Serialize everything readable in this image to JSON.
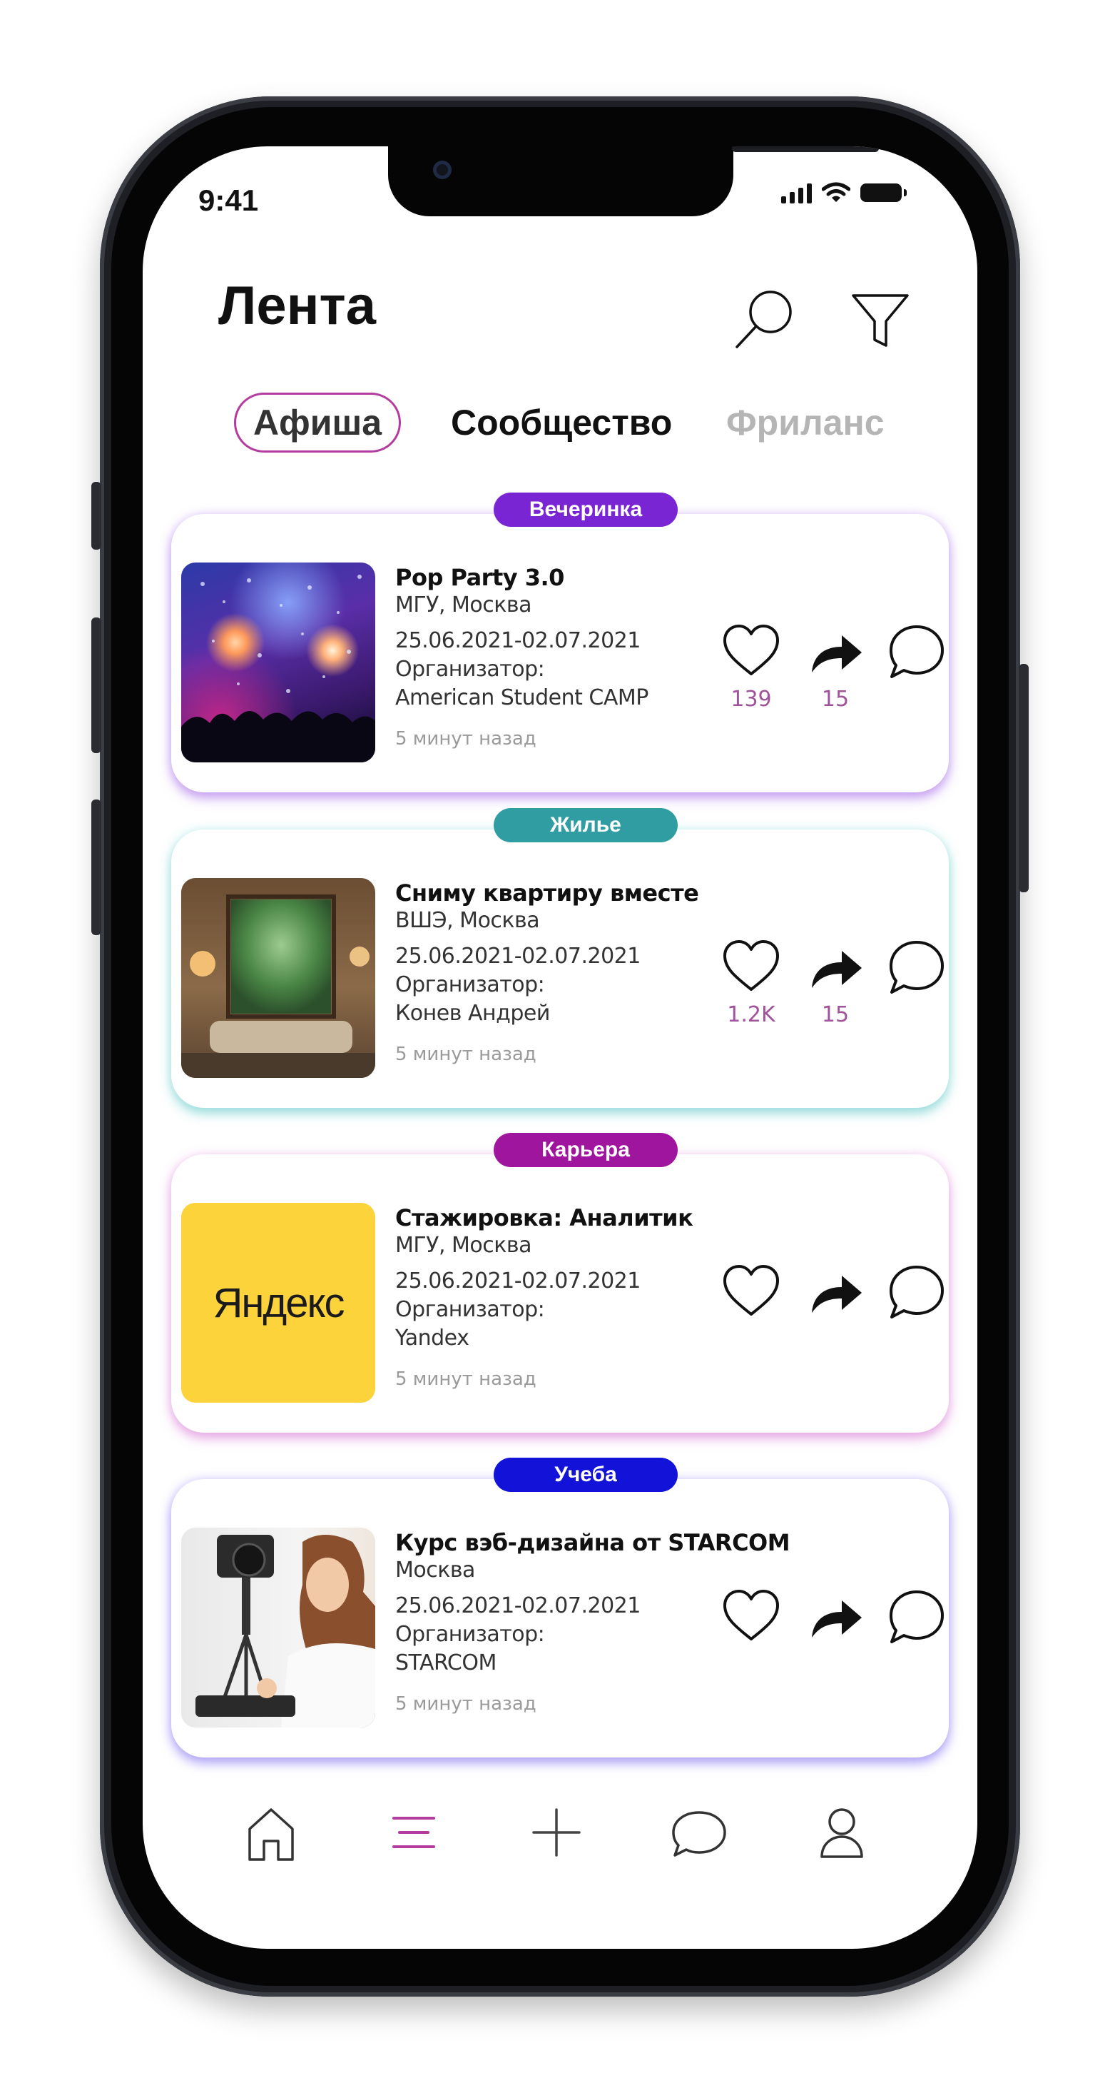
{
  "status_bar": {
    "time": "9:41"
  },
  "header": {
    "title": "Лента",
    "search_icon": "search-icon",
    "filter_icon": "filter-icon"
  },
  "tabs": [
    {
      "label": "Афиша",
      "active": true
    },
    {
      "label": "Сообщество",
      "active": false
    },
    {
      "label": "Фриланс",
      "active": false
    }
  ],
  "colors": {
    "accent": "#b33c9e",
    "badge_party": "#7a25d3",
    "badge_housing": "#2f9da2",
    "badge_career": "#a0159e",
    "badge_study": "#1212d9",
    "count_text": "#a0539a"
  },
  "feed": [
    {
      "badge": "Вечеринка",
      "image": "party-photo",
      "title": "Pop Party 3.0",
      "location": "МГУ, Москва",
      "dates": "25.06.2021-02.07.2021",
      "organizer_label": "Организатор:",
      "organizer": "American Student CAMP",
      "time_ago": "5 минут назад",
      "likes": "139",
      "shares": "15"
    },
    {
      "badge": "Жилье",
      "image": "apartment-photo",
      "title": "Сниму квартиру вместе",
      "location": "ВШЭ, Москва",
      "dates": "25.06.2021-02.07.2021",
      "organizer_label": "Организатор:",
      "organizer": "Конев Андрей",
      "time_ago": "5 минут назад",
      "likes": "1.2K",
      "shares": "15"
    },
    {
      "badge": "Карьера",
      "image": "yandex-logo",
      "logo_text": "Яндекс",
      "title": "Стажировка: Аналитик",
      "location": "МГУ, Москва",
      "dates": "25.06.2021-02.07.2021",
      "organizer_label": "Организатор:",
      "organizer": "Yandex",
      "time_ago": "5 минут назад"
    },
    {
      "badge": "Учеба",
      "image": "designer-photo",
      "title": "Курс вэб-дизайна от STARCOM",
      "location": "Москва",
      "dates": "25.06.2021-02.07.2021",
      "organizer_label": "Организатор:",
      "organizer": "STARCOM",
      "time_ago": "5 минут назад"
    }
  ],
  "bottom_nav": [
    {
      "icon": "home-icon",
      "active": false
    },
    {
      "icon": "feed-icon",
      "active": true
    },
    {
      "icon": "plus-icon",
      "active": false
    },
    {
      "icon": "chat-icon",
      "active": false
    },
    {
      "icon": "profile-icon",
      "active": false
    }
  ]
}
